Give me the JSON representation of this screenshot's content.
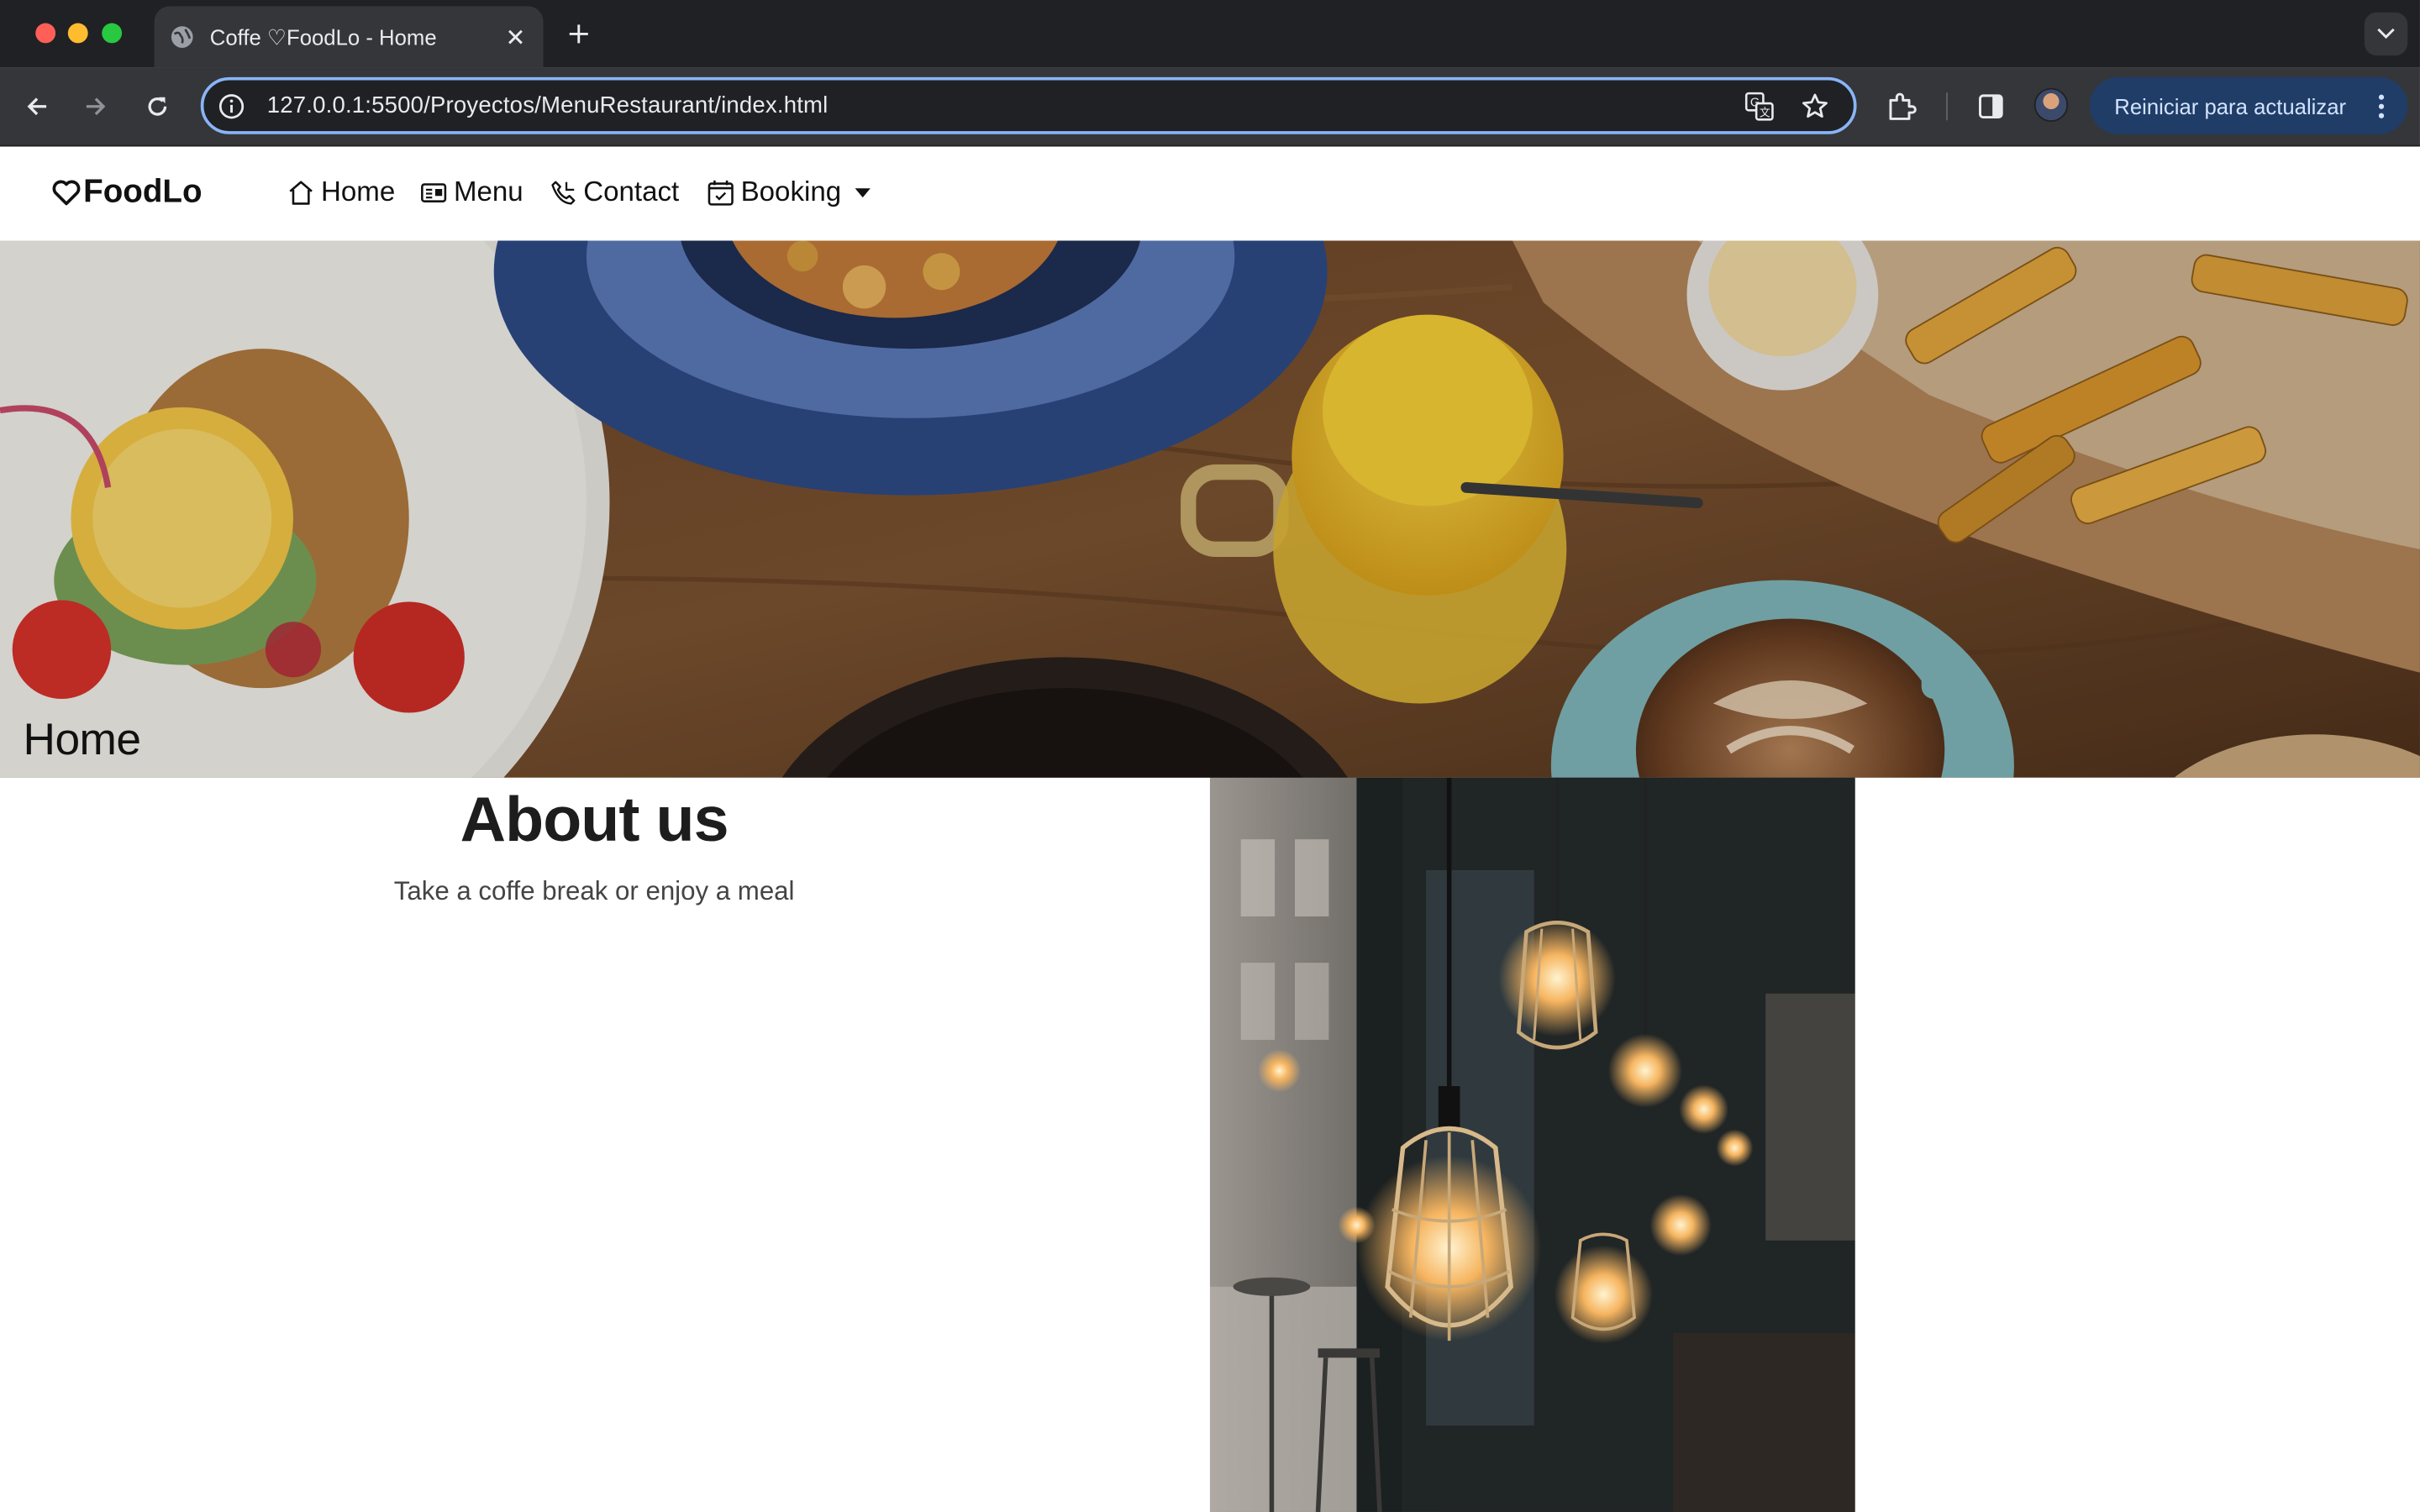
{
  "browser": {
    "tab_title": "Coffe ♡FoodLo - Home",
    "url": "127.0.0.1:5500/Proyectos/MenuRestaurant/index.html",
    "update_button_label": "Reiniciar para actualizar"
  },
  "navbar": {
    "brand": "FoodLo",
    "items": [
      {
        "label": "Home",
        "icon": "home-icon"
      },
      {
        "label": "Menu",
        "icon": "menu-card-icon"
      },
      {
        "label": "Contact",
        "icon": "phone-icon"
      },
      {
        "label": "Booking",
        "icon": "calendar-check-icon",
        "dropdown": true
      }
    ]
  },
  "hero": {
    "title": "Home",
    "image": "food-table-photo"
  },
  "about": {
    "title": "About us",
    "subtitle": "Take a coffe break or enjoy a meal",
    "image": "hanging-lamps-photo"
  },
  "colors": {
    "chrome_dark": "#202124",
    "chrome_toolbar": "#35363a",
    "omnibox_focus": "#8ab4f8",
    "update_button": "#1f3d67",
    "text_dark": "#111111"
  }
}
